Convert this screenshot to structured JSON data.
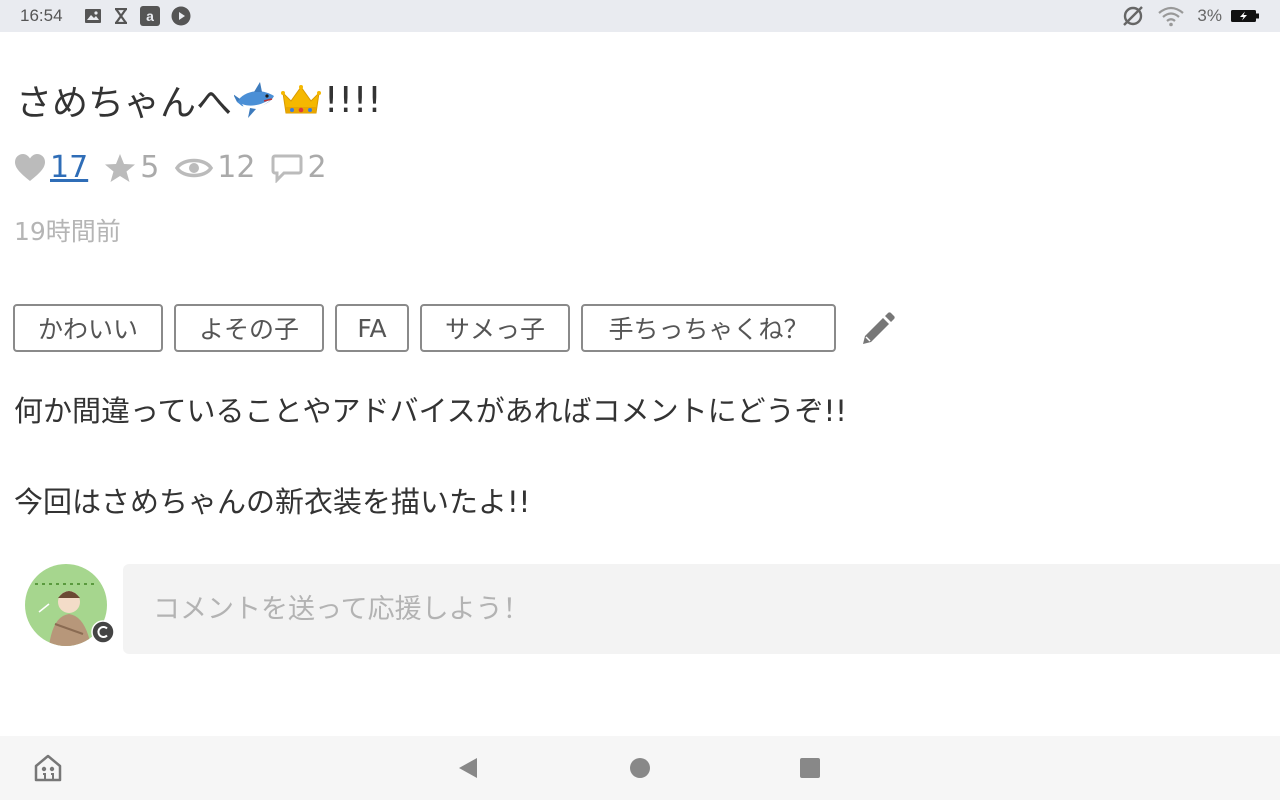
{
  "status_bar": {
    "time": "16:54",
    "battery_percent": "3%",
    "icons": [
      "image-icon",
      "x-icon",
      "amazon-icon",
      "play-icon",
      "no-sync-icon",
      "wifi-icon",
      "battery-charging-icon"
    ]
  },
  "post": {
    "title": "さめちゃんへ",
    "title_emojis": [
      "shark-icon",
      "crown-icon"
    ],
    "title_suffix": "!!!!",
    "stats": {
      "likes": "17",
      "bookmarks": "5",
      "views": "12",
      "comments": "2"
    },
    "time_ago": "19時間前",
    "tags": [
      "かわいい",
      "よその子",
      "FA",
      "サメっ子",
      "手ちっちゃくね？"
    ],
    "description": [
      "何か間違っていることやアドバイスがあればコメントにどうぞ!!",
      "今回はさめちゃんの新衣装を描いたよ!!"
    ]
  },
  "comment": {
    "placeholder": "コメントを送って応援しよう！"
  },
  "colors": {
    "link_blue": "#2f6db7",
    "muted_gray": "#aaaaaa",
    "avatar_green": "#a6d68e"
  }
}
